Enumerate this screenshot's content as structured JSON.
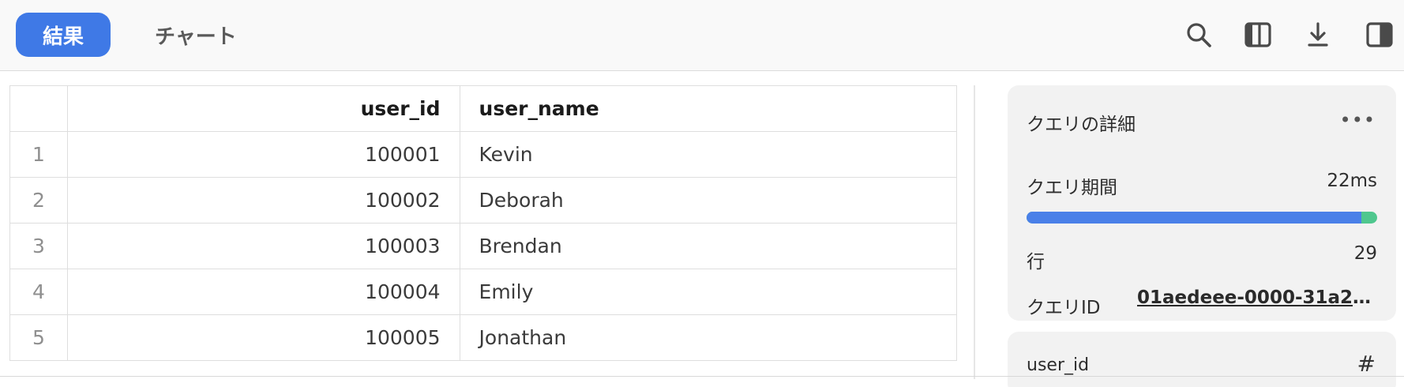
{
  "tabs": {
    "results": "結果",
    "chart": "チャート"
  },
  "toolbar": {
    "icons": [
      "search-icon",
      "columns-icon",
      "download-icon",
      "panel-toggle-icon"
    ]
  },
  "table": {
    "headers": [
      "",
      "user_id",
      "user_name"
    ],
    "rows": [
      {
        "index": "1",
        "user_id": "100001",
        "user_name": "Kevin"
      },
      {
        "index": "2",
        "user_id": "100002",
        "user_name": "Deborah"
      },
      {
        "index": "3",
        "user_id": "100003",
        "user_name": "Brendan"
      },
      {
        "index": "4",
        "user_id": "100004",
        "user_name": "Emily"
      },
      {
        "index": "5",
        "user_id": "100005",
        "user_name": "Jonathan"
      }
    ]
  },
  "details": {
    "title": "クエリの詳細",
    "more": "•••",
    "duration_label": "クエリ期間",
    "duration_value": "22ms",
    "duration_fraction": 0.955,
    "rows_label": "行",
    "rows_value": "29",
    "query_id_label": "クエリID",
    "query_id_value": "01aedeee-0000-31a2-0..."
  },
  "column_card": {
    "name": "user_id",
    "type_symbol": "#"
  },
  "colors": {
    "accent": "#3f79e6",
    "bar_blue": "#4a80e8",
    "bar_green": "#4fc78e"
  }
}
